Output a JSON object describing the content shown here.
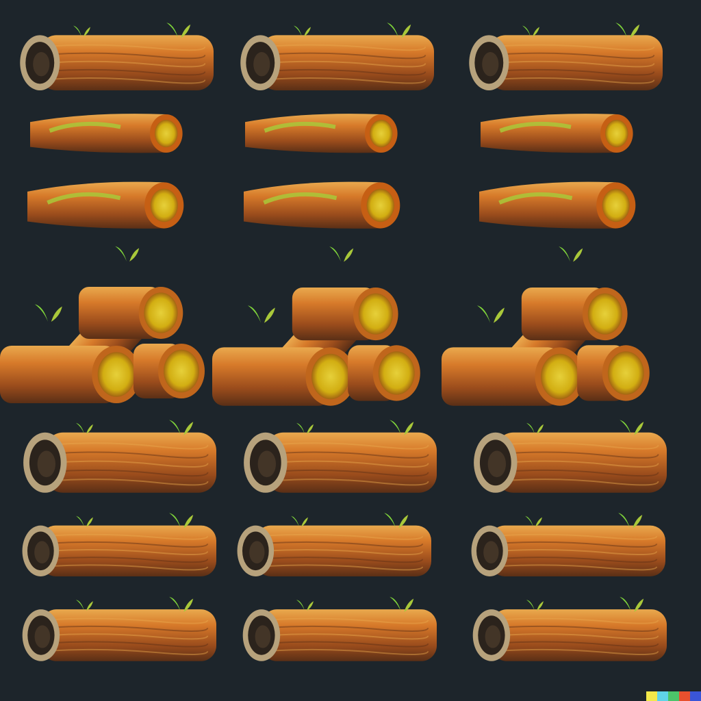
{
  "sprite_sheet": {
    "background": "#1d252b",
    "palette": {
      "bark_dark": "#5a2f16",
      "bark_mid": "#9a4c1c",
      "bark_light": "#d77a2a",
      "bark_highlight": "#e9a94e",
      "moss": "#a9c83a",
      "sprout": "#7fd43a",
      "core": "#d2ae12",
      "hollow": "#2b231c",
      "hollow_rim": "#b7a27c"
    },
    "rows": [
      {
        "kind": "hollow-log-with-sprouts",
        "count": 3
      },
      {
        "kind": "mossy-branch-right-end",
        "count": 3
      },
      {
        "kind": "mossy-branch-right-end",
        "count": 3
      },
      {
        "kind": "stacked-logs-pile",
        "count": 3
      },
      {
        "kind": "hollow-log-with-sprouts",
        "count": 3
      },
      {
        "kind": "hollow-log-with-sprouts",
        "count": 3
      },
      {
        "kind": "hollow-log-with-sprouts",
        "count": 3
      }
    ]
  },
  "color_strip": [
    "#f2e84a",
    "#5fd3e8",
    "#4cc46a",
    "#e8502e",
    "#3a55d8"
  ]
}
